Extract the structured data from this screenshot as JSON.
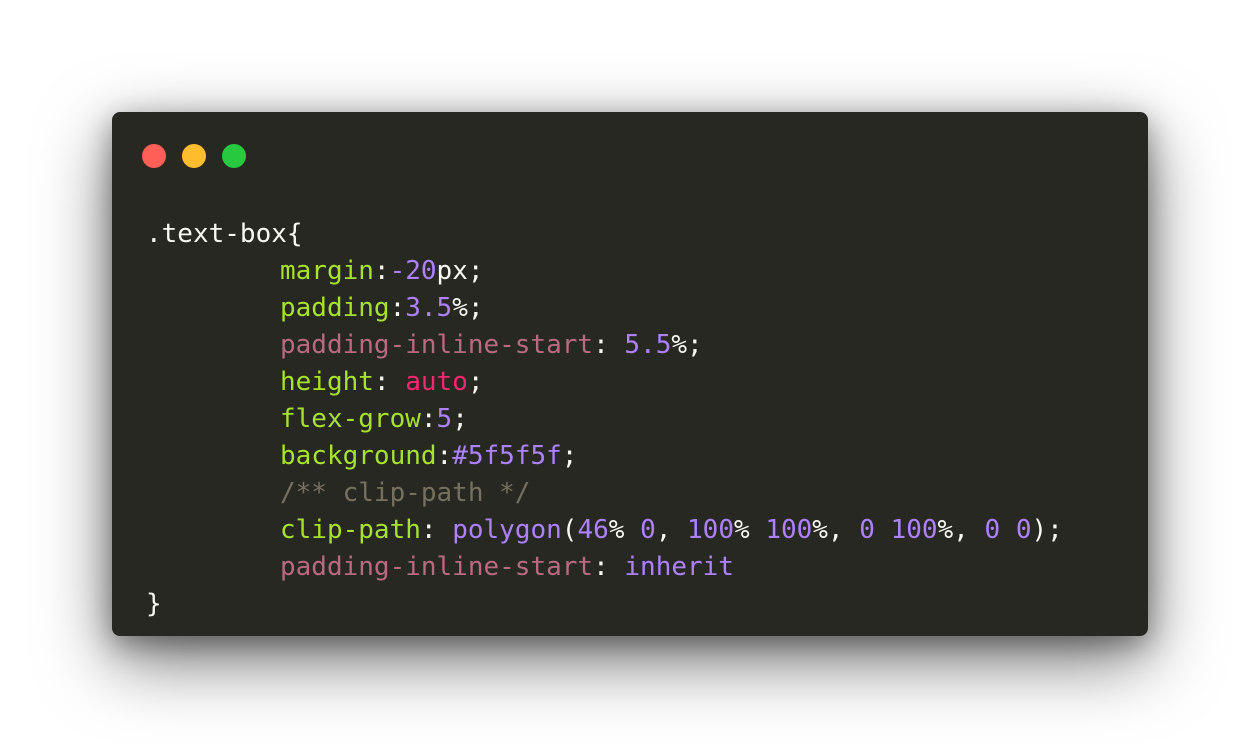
{
  "window": {
    "background": "#272822",
    "controls": [
      {
        "name": "close",
        "color": "#ff5f56"
      },
      {
        "name": "minimize",
        "color": "#ffbd2e"
      },
      {
        "name": "zoom",
        "color": "#27c93f"
      }
    ]
  },
  "palette": {
    "plain": "#f8f8f2",
    "property": "#a6e22e",
    "property_alt": "#b86a80",
    "number": "#ae81ff",
    "keyword": "#f92672",
    "comment": "#75715e"
  },
  "code": {
    "lines": [
      {
        "indent": false,
        "tokens": [
          {
            "t": ".text-box{",
            "c": "plain"
          }
        ]
      },
      {
        "indent": true,
        "tokens": [
          {
            "t": "margin",
            "c": "prop"
          },
          {
            "t": ":",
            "c": "plain"
          },
          {
            "t": "-20",
            "c": "num"
          },
          {
            "t": "px;",
            "c": "plain"
          }
        ]
      },
      {
        "indent": true,
        "tokens": [
          {
            "t": "padding",
            "c": "prop"
          },
          {
            "t": ":",
            "c": "plain"
          },
          {
            "t": "3.5",
            "c": "num"
          },
          {
            "t": "%;",
            "c": "plain"
          }
        ]
      },
      {
        "indent": true,
        "tokens": [
          {
            "t": "padding-inline-start",
            "c": "prop-alt"
          },
          {
            "t": ": ",
            "c": "plain"
          },
          {
            "t": "5.5",
            "c": "num"
          },
          {
            "t": "%;",
            "c": "plain"
          }
        ]
      },
      {
        "indent": true,
        "tokens": [
          {
            "t": "height",
            "c": "prop"
          },
          {
            "t": ": ",
            "c": "plain"
          },
          {
            "t": "auto",
            "c": "kw"
          },
          {
            "t": ";",
            "c": "plain"
          }
        ]
      },
      {
        "indent": true,
        "tokens": [
          {
            "t": "flex-grow",
            "c": "prop"
          },
          {
            "t": ":",
            "c": "plain"
          },
          {
            "t": "5",
            "c": "num"
          },
          {
            "t": ";",
            "c": "plain"
          }
        ]
      },
      {
        "indent": true,
        "tokens": [
          {
            "t": "background",
            "c": "prop"
          },
          {
            "t": ":",
            "c": "plain"
          },
          {
            "t": "#5f5f5f",
            "c": "num"
          },
          {
            "t": ";",
            "c": "plain"
          }
        ]
      },
      {
        "indent": true,
        "tokens": [
          {
            "t": "/** clip-path */",
            "c": "comment"
          }
        ]
      },
      {
        "indent": true,
        "tokens": [
          {
            "t": "clip-path",
            "c": "prop"
          },
          {
            "t": ": ",
            "c": "plain"
          },
          {
            "t": "polygon",
            "c": "num"
          },
          {
            "t": "(",
            "c": "plain"
          },
          {
            "t": "46",
            "c": "num"
          },
          {
            "t": "% ",
            "c": "plain"
          },
          {
            "t": "0",
            "c": "num"
          },
          {
            "t": ", ",
            "c": "plain"
          },
          {
            "t": "100",
            "c": "num"
          },
          {
            "t": "% ",
            "c": "plain"
          },
          {
            "t": "100",
            "c": "num"
          },
          {
            "t": "%, ",
            "c": "plain"
          },
          {
            "t": "0",
            "c": "num"
          },
          {
            "t": " ",
            "c": "plain"
          },
          {
            "t": "100",
            "c": "num"
          },
          {
            "t": "%, ",
            "c": "plain"
          },
          {
            "t": "0",
            "c": "num"
          },
          {
            "t": " ",
            "c": "plain"
          },
          {
            "t": "0",
            "c": "num"
          },
          {
            "t": ");",
            "c": "plain"
          }
        ]
      },
      {
        "indent": true,
        "tokens": [
          {
            "t": "padding-inline-start",
            "c": "prop-alt"
          },
          {
            "t": ": ",
            "c": "plain"
          },
          {
            "t": "inherit",
            "c": "num"
          }
        ]
      },
      {
        "indent": false,
        "tokens": [
          {
            "t": "}",
            "c": "plain"
          }
        ]
      }
    ]
  }
}
